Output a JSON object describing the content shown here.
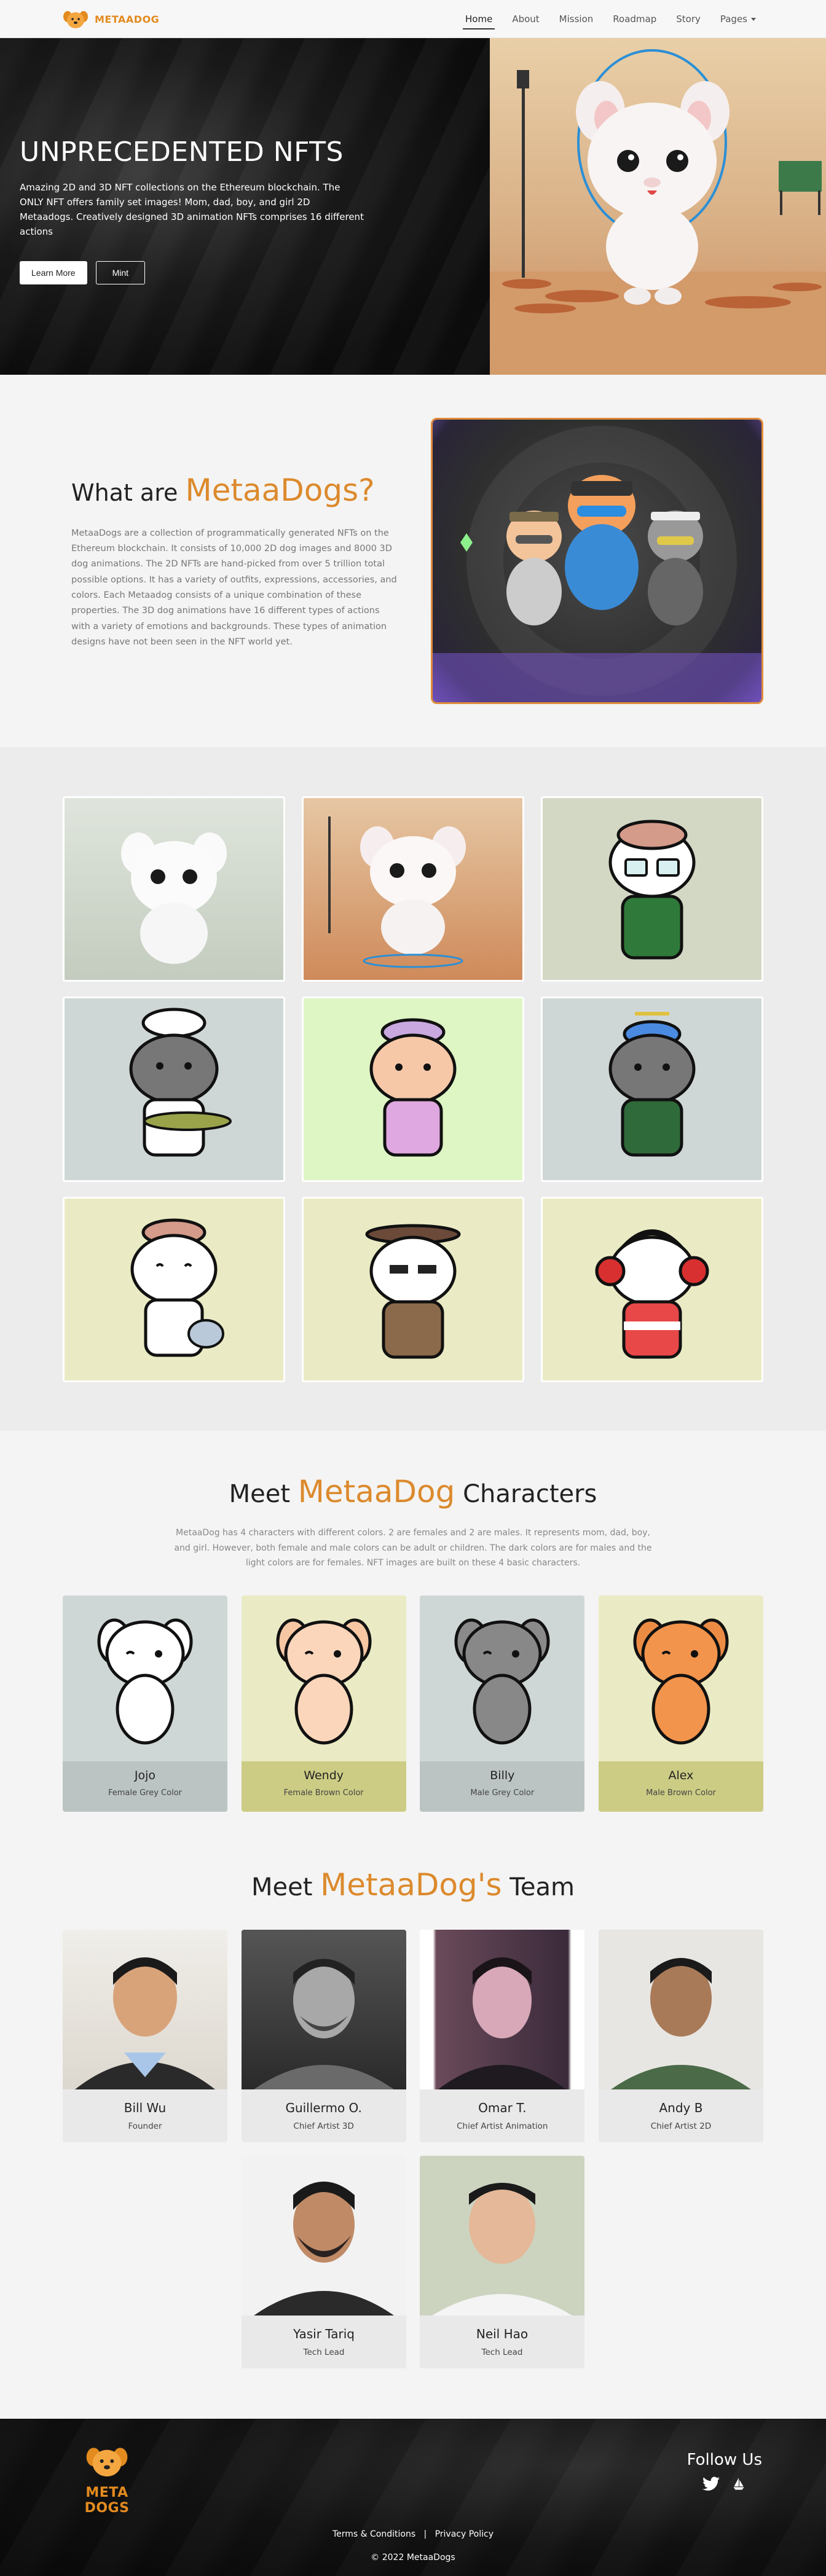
{
  "navbar": {
    "brand": "METAADOG",
    "items": [
      {
        "label": "Home",
        "active": true
      },
      {
        "label": "About",
        "active": false
      },
      {
        "label": "Mission",
        "active": false
      },
      {
        "label": "Roadmap",
        "active": false
      },
      {
        "label": "Story",
        "active": false
      },
      {
        "label": "Pages",
        "active": false
      }
    ]
  },
  "hero": {
    "title": "UNPRECEDENTED NFTS",
    "text": "Amazing 2D and 3D NFT collections on the Ethereum blockchain. The ONLY NFT offers family set images! Mom, dad, boy, and girl 2D Metaadogs. Creatively designed 3D animation NFTs comprises 16 different actions",
    "learn_more": "Learn More",
    "mint": "Mint"
  },
  "what": {
    "title_prefix": "What are",
    "title_accent": "MetaaDogs?",
    "text": "MetaaDogs are a collection of programmatically generated NFTs on the Ethereum blockchain. It consists of 10,000 2D dog images and 8000 3D dog animations. The 2D NFTs are hand-picked from over 5 trillion total possible options. It has a variety of outfits, expressions, accessories, and colors. Each Metaadog consists of a unique combination of these properties. The 3D dog animations have 16 different types of actions with a variety of emotions and backgrounds. These types of animation designs have not been seen in the NFT world yet."
  },
  "characters": {
    "title_prefix": "Meet",
    "title_accent": "MetaaDog",
    "title_suffix": "Characters",
    "text": "MetaaDog has 4 characters with different colors. 2 are females and 2 are males. It represents mom, dad, boy, and girl. However, both female and male colors can be adult or children. The dark colors are for males and the light colors are for females. NFT images are built on these 4 basic characters.",
    "items": [
      {
        "name": "Jojo",
        "subtitle": "Female Grey Color"
      },
      {
        "name": "Wendy",
        "subtitle": "Female Brown Color"
      },
      {
        "name": "Billy",
        "subtitle": "Male Grey Color"
      },
      {
        "name": "Alex",
        "subtitle": "Male Brown Color"
      }
    ]
  },
  "team": {
    "title_prefix": "Meet",
    "title_accent": "MetaaDog's",
    "title_suffix": "Team",
    "members": [
      {
        "name": "Bill Wu",
        "role": "Founder"
      },
      {
        "name": "Guillermo O.",
        "role": "Chief Artist 3D"
      },
      {
        "name": "Omar T.",
        "role": "Chief Artist Animation"
      },
      {
        "name": "Andy B",
        "role": "Chief Artist 2D"
      },
      {
        "name": "Yasir Tariq",
        "role": "Tech Lead"
      },
      {
        "name": "Neil Hao",
        "role": "Tech Lead"
      }
    ]
  },
  "footer": {
    "logo_text": "META DOGS",
    "follow_title": "Follow Us",
    "terms": "Terms & Conditions",
    "separator": "|",
    "privacy": "Privacy Policy",
    "copyright": "© 2022 MetaaDogs"
  },
  "colors": {
    "accent": "#dc8a2d",
    "brand": "#e38b1f"
  }
}
